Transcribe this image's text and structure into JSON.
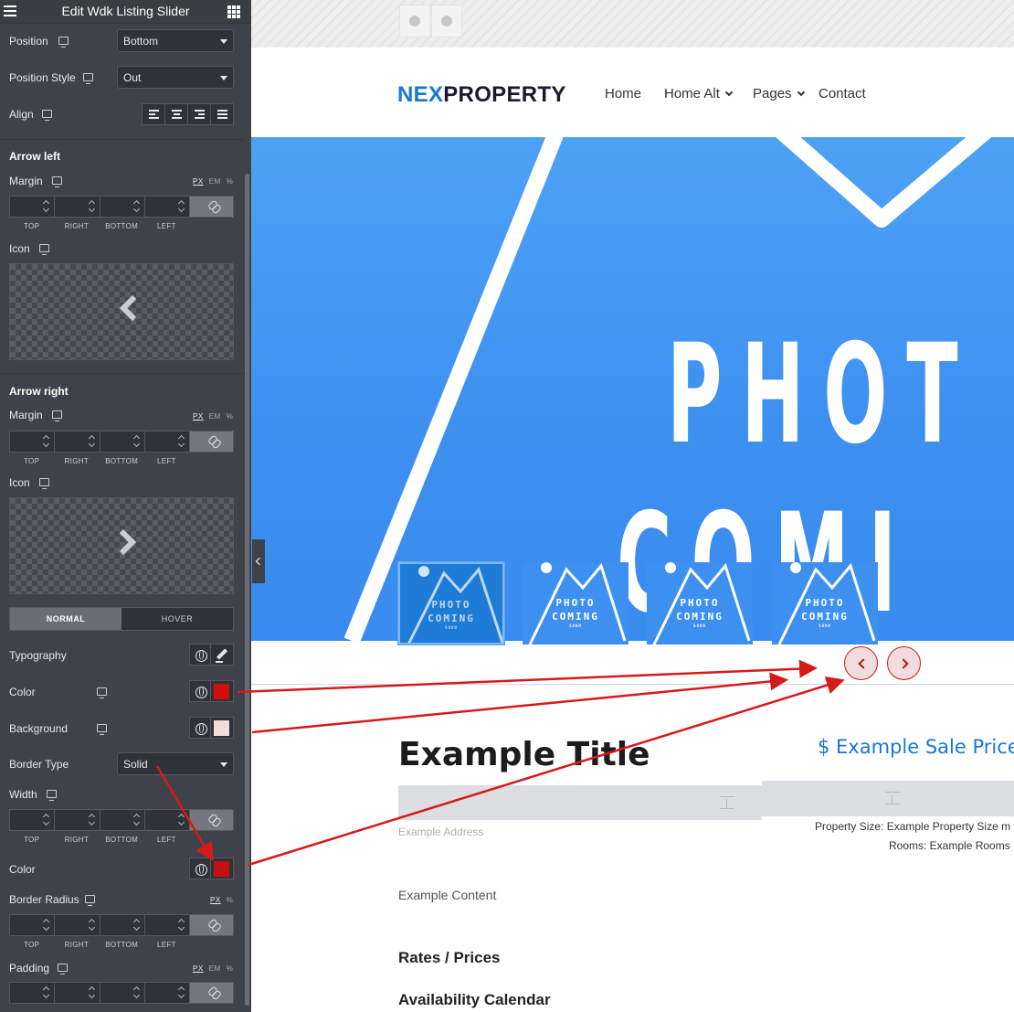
{
  "panel": {
    "title": "Edit Wdk Listing Slider",
    "position": {
      "label": "Position",
      "value": "Bottom"
    },
    "position_style": {
      "label": "Position Style",
      "value": "Out"
    },
    "align": {
      "label": "Align"
    },
    "arrow_left": {
      "heading": "Arrow left",
      "margin_label": "Margin",
      "units": [
        "PX",
        "EM",
        "%"
      ],
      "dims": [
        "TOP",
        "RIGHT",
        "BOTTOM",
        "LEFT"
      ],
      "icon_label": "Icon"
    },
    "arrow_right": {
      "heading": "Arrow right",
      "margin_label": "Margin",
      "units": [
        "PX",
        "EM",
        "%"
      ],
      "dims": [
        "TOP",
        "RIGHT",
        "BOTTOM",
        "LEFT"
      ],
      "icon_label": "Icon"
    },
    "tabs": {
      "normal": "NORMAL",
      "hover": "HOVER"
    },
    "typography_label": "Typography",
    "color_label": "Color",
    "color_value": "#d10f0f",
    "background_label": "Background",
    "background_value": "#f3dcdc",
    "border_type": {
      "label": "Border Type",
      "value": "Solid"
    },
    "width": {
      "label": "Width",
      "dims": [
        "TOP",
        "RIGHT",
        "BOTTOM",
        "LEFT"
      ]
    },
    "border_color_label": "Color",
    "border_color_value": "#c41010",
    "border_radius": {
      "label": "Border Radius",
      "units": [
        "PX",
        "%"
      ],
      "dims": [
        "TOP",
        "RIGHT",
        "BOTTOM",
        "LEFT"
      ]
    },
    "padding": {
      "label": "Padding",
      "units": [
        "PX",
        "EM",
        "%"
      ]
    }
  },
  "site": {
    "logo_a": "NEX",
    "logo_b": "PROPERTY",
    "nav": [
      "Home",
      "Home Alt",
      "Pages",
      "Contact"
    ],
    "hero_text_1": "PHOT",
    "hero_text_2": "COMI",
    "thumb_text_1": "PHOTO",
    "thumb_text_2": "COMING",
    "thumb_text_3": "SOON",
    "title": "Example Title",
    "price": "$ Example Sale Price",
    "address": "Example Address",
    "property_size": "Property Size: Example Property Size m",
    "rooms": "Rooms: Example Rooms",
    "content": "Example Content",
    "rates": "Rates / Prices",
    "availability": "Availability Calendar"
  },
  "colors": {
    "brand_blue": "#1877d6",
    "panel_bg": "#3f4248",
    "annotation_red": "#d61a1a"
  }
}
